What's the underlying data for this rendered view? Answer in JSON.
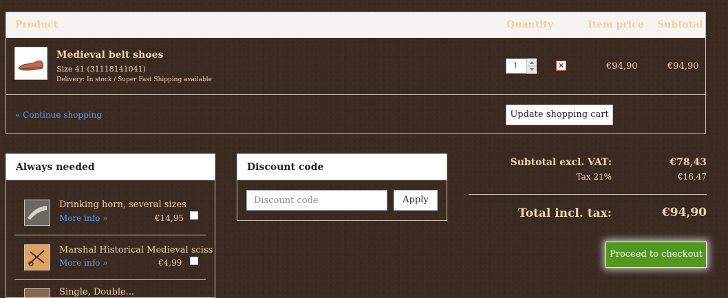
{
  "cart": {
    "headers": {
      "product": "Product",
      "quantity": "Quantity",
      "item_price": "Item price",
      "subtotal": "Subtotal"
    },
    "item": {
      "name": "Medieval belt shoes",
      "size": "Size 41 (31118141041)",
      "delivery": "Delivery: In stock / Super Fast Shipping available",
      "quantity": "1",
      "item_price": "€94,90",
      "subtotal": "€94,90"
    },
    "continue_link": "« Continue shopping",
    "update_button": "Update shopping cart"
  },
  "always_needed": {
    "title": "Always needed",
    "items": [
      {
        "name": "Drinking horn, several sizes",
        "more": "More info »",
        "price": "€14,95"
      },
      {
        "name": "Marshal Historical Medieval sciss",
        "more": "More info »",
        "price": "€4,99"
      },
      {
        "name": "Single, Double..."
      }
    ]
  },
  "discount": {
    "title": "Discount code",
    "placeholder": "Discount code",
    "apply": "Apply"
  },
  "totals": {
    "subtotal_label": "Subtotal excl. VAT:",
    "subtotal_value": "€78,43",
    "tax_label": "Tax 21%",
    "tax_value": "€16,47",
    "total_label": "Total incl. tax:",
    "total_value": "€94,90"
  },
  "checkout_button": "Proceed to checkout",
  "colors": {
    "accent_green": "#4f9a1c",
    "link_blue": "#4ba0ff",
    "remove_red": "#d3463a"
  }
}
